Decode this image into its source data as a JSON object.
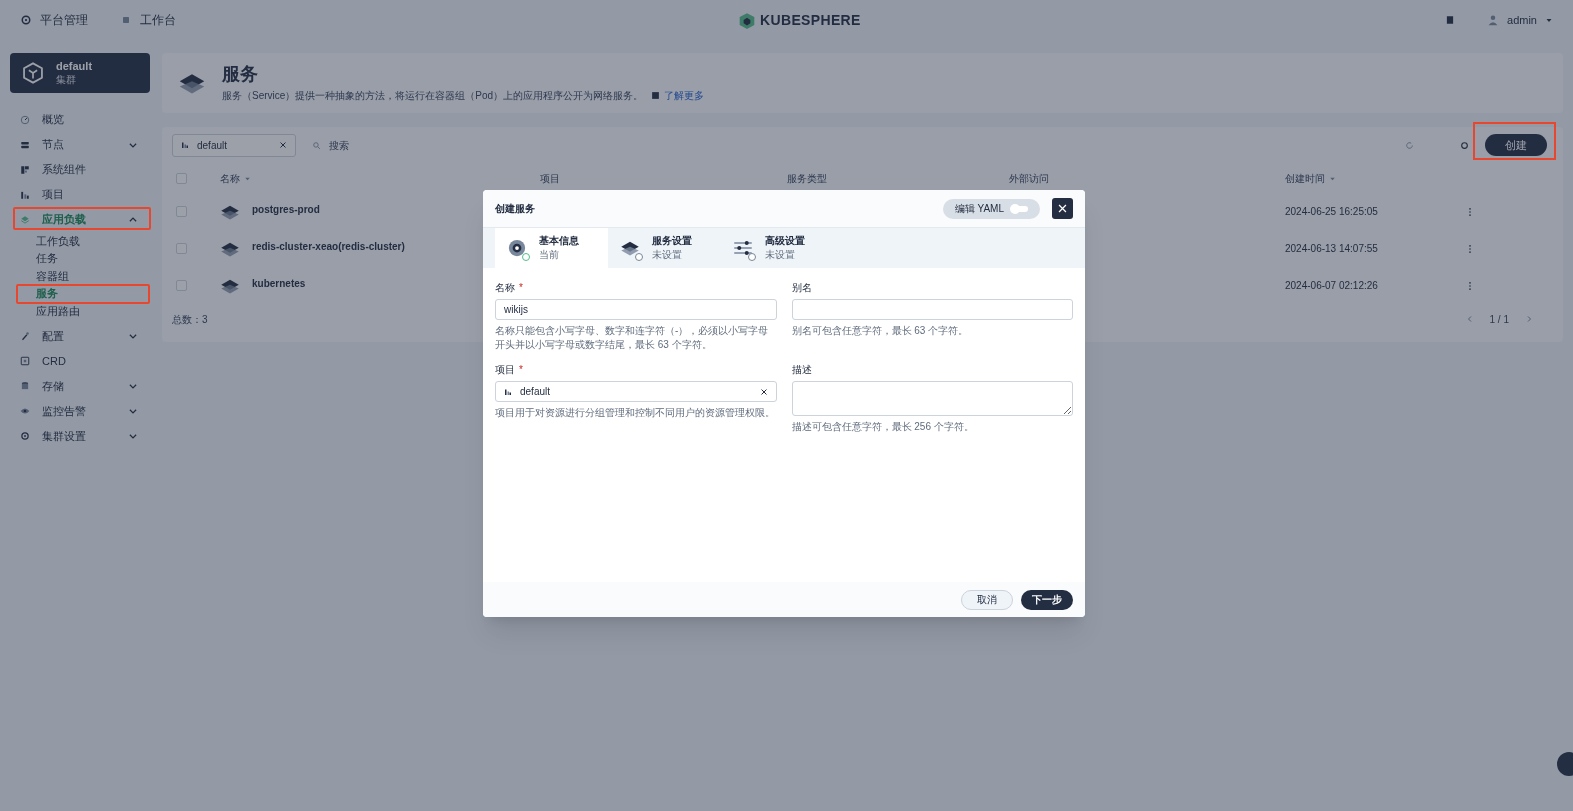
{
  "top_bar": {
    "nav": [
      {
        "label": "平台管理"
      },
      {
        "label": "工作台"
      }
    ],
    "logo": "KUBESPHERE",
    "user": "admin"
  },
  "sidebar": {
    "cluster": {
      "name": "default",
      "kind": "集群"
    },
    "items": [
      {
        "label": "概览",
        "kind": "link",
        "active": false
      },
      {
        "label": "节点",
        "kind": "group",
        "expanded": false,
        "active": false
      },
      {
        "label": "系统组件",
        "kind": "link",
        "active": false
      },
      {
        "label": "项目",
        "kind": "link",
        "active": false
      },
      {
        "label": "应用负载",
        "kind": "group",
        "expanded": true,
        "active": true,
        "children": [
          {
            "label": "工作负载",
            "selected": false
          },
          {
            "label": "任务",
            "selected": false
          },
          {
            "label": "容器组",
            "selected": false
          },
          {
            "label": "服务",
            "selected": true
          },
          {
            "label": "应用路由",
            "selected": false
          }
        ]
      },
      {
        "label": "配置",
        "kind": "group",
        "expanded": false,
        "active": false
      },
      {
        "label": "CRD",
        "kind": "link",
        "active": false
      },
      {
        "label": "存储",
        "kind": "group",
        "expanded": false,
        "active": false
      },
      {
        "label": "监控告警",
        "kind": "group",
        "expanded": false,
        "active": false
      },
      {
        "label": "集群设置",
        "kind": "group",
        "expanded": false,
        "active": false
      }
    ]
  },
  "page_header": {
    "title": "服务",
    "description": "服务（Service）提供一种抽象的方法，将运行在容器组（Pod）上的应用程序公开为网络服务。",
    "link": "了解更多"
  },
  "toolbar": {
    "filter": "default",
    "search": {
      "placeholder": "搜索"
    },
    "create_button": "创建"
  },
  "table": {
    "select_all": {
      "checked": false
    },
    "columns": [
      "名称",
      "项目",
      "服务类型",
      "外部访问",
      "创建时间"
    ],
    "rows": [
      {
        "checked": false,
        "name": "postgres-prod",
        "created": "2024-06-25 16:25:05"
      },
      {
        "checked": false,
        "name": "redis-cluster-xeao(redis-cluster)",
        "created": "2024-06-13 14:07:55"
      },
      {
        "checked": false,
        "name": "kubernetes",
        "created": "2024-06-07 02:12:26"
      }
    ],
    "total": "总数：3",
    "pagination": "1 / 1"
  },
  "dialog": {
    "title": "创建服务",
    "yaml_toggle": {
      "label": "编辑 YAML",
      "on": false
    },
    "steps": [
      {
        "title": "基本信息",
        "status": "当前",
        "selected": true
      },
      {
        "title": "服务设置",
        "status": "未设置",
        "selected": false
      },
      {
        "title": "高级设置",
        "status": "未设置",
        "selected": false
      }
    ],
    "fields": [
      {
        "kind": "input",
        "label": "名称",
        "required_mark": "*",
        "value": "wikijs",
        "hint": "名称只能包含小写字母、数字和连字符（-），必须以小写字母开头并以小写字母或数字结尾，最长 63 个字符。"
      },
      {
        "kind": "input",
        "label": "别名",
        "hint": "别名可包含任意字符，最长 63 个字符。"
      },
      {
        "kind": "select",
        "label": "项目",
        "required_mark": "*",
        "value": "default",
        "hint": "项目用于对资源进行分组管理和控制不同用户的资源管理权限。"
      },
      {
        "kind": "textarea",
        "label": "描述",
        "hint": "描述可包含任意字符，最长 256 个字符。"
      }
    ],
    "buttons": [
      {
        "label": "取消",
        "kind": "secondary"
      },
      {
        "label": "下一步",
        "kind": "primary"
      }
    ]
  }
}
